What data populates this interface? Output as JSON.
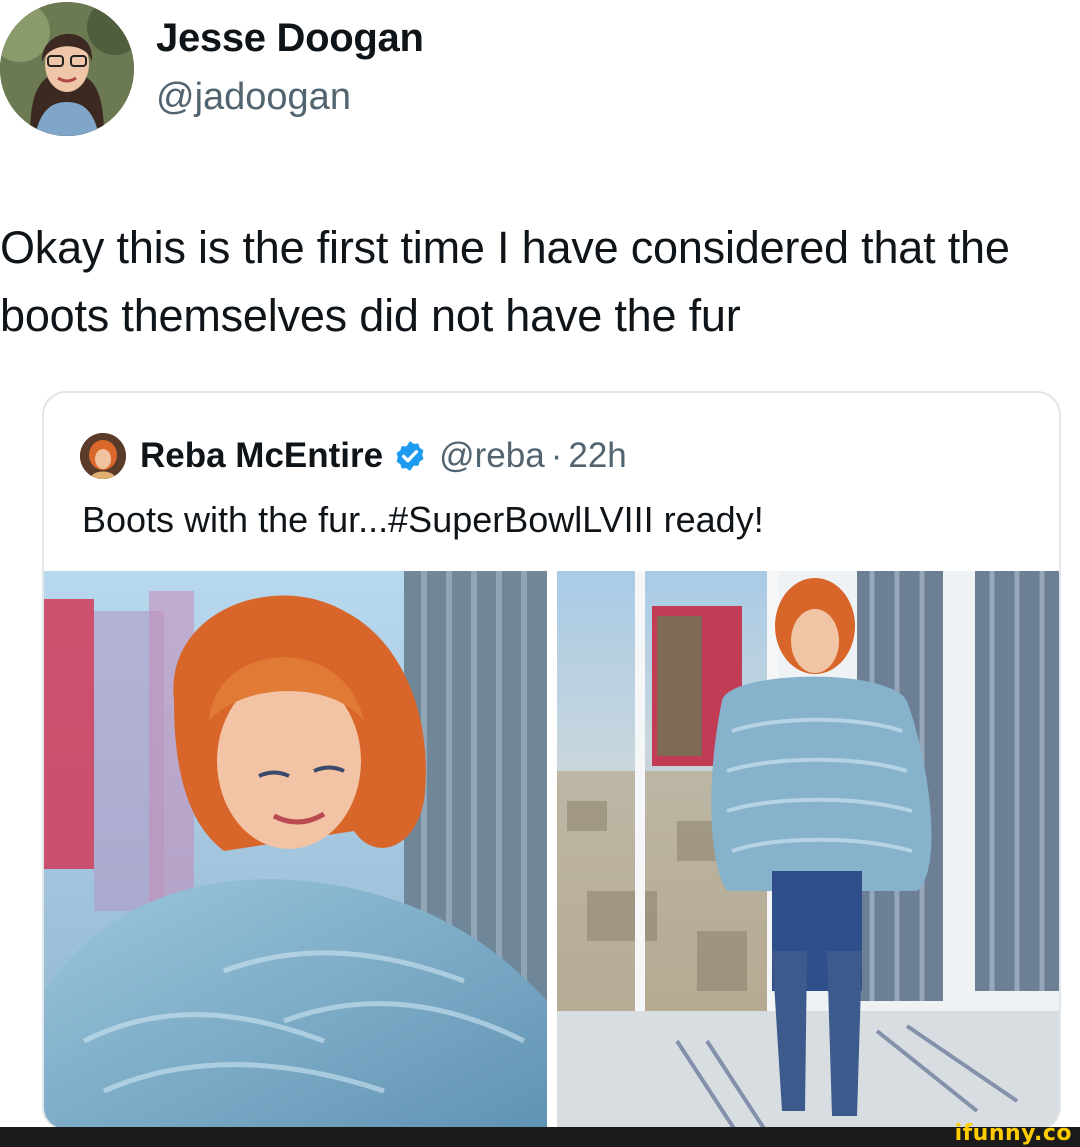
{
  "tweet": {
    "author_name": "Jesse Doogan",
    "author_handle": "@jadoogan",
    "text": "Okay this is the first time I have considered that the boots themselves did not have the fur"
  },
  "quoted_tweet": {
    "author_name": "Reba McEntire",
    "author_handle": "@reba",
    "separator": "·",
    "time": "22h",
    "verified_icon": "verified-badge-icon",
    "text": "Boots with the fur...#SuperBowlLVIII  ready!"
  },
  "watermark": "ifunny.co",
  "colors": {
    "secondary_text": "#536471",
    "verified": "#1d9bf0",
    "card_border": "#e1e6ea",
    "watermark": "#ffcc00"
  }
}
